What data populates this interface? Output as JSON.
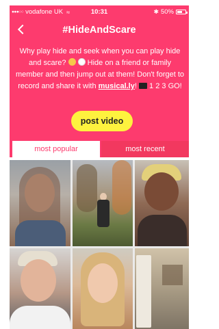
{
  "status_bar": {
    "carrier": "vodafone UK",
    "time": "10:31",
    "battery": "50%"
  },
  "header": {
    "title": "#HideAndScare",
    "description_parts": {
      "line1": "Why play hide and seek when you can play hide and scare?",
      "line2": "Hide on a friend or family member and then jump out at them! Don't forget to record and share it with",
      "link": "musical.ly",
      "line3": "! ",
      "countdown": "1 2 3 GO!"
    },
    "post_button": "post video"
  },
  "tabs": [
    {
      "label": "most popular",
      "active": true
    },
    {
      "label": "most recent",
      "active": false
    }
  ],
  "colors": {
    "accent": "#fd3b6e",
    "button": "#fef23e"
  },
  "icons": [
    "back-icon",
    "wifi-icon",
    "bluetooth-icon",
    "battery-icon"
  ],
  "videos": [
    {
      "position": "top-left"
    },
    {
      "position": "top-center"
    },
    {
      "position": "top-right"
    },
    {
      "position": "bottom-left"
    },
    {
      "position": "bottom-center"
    },
    {
      "position": "bottom-right"
    }
  ]
}
